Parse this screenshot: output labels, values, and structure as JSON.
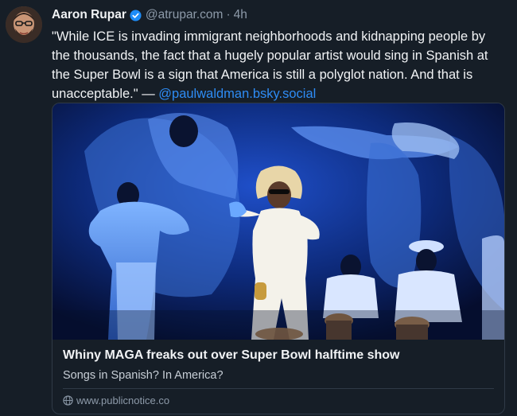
{
  "post": {
    "author": {
      "display_name": "Aaron Rupar",
      "handle": "@atrupar.com",
      "verified": true
    },
    "separator": "·",
    "time": "4h",
    "text_quote": "\"While ICE is invading immigrant neighborhoods and kidnapping people by the thousands, the fact that a hugely popular artist would sing in Spanish at the Super Bowl is a sign that America is still a polyglot nation. And that is unacceptable.\" — ",
    "text_mention": "@paulwaldman.bsky.social"
  },
  "link_card": {
    "title": "Whiny MAGA freaks out over Super Bowl halftime show",
    "description": "Songs in Spanish? In America?",
    "domain": "www.publicnotice.co",
    "domain_icon": "globe-icon"
  },
  "colors": {
    "background": "#161e27",
    "text": "#f1f3f5",
    "muted": "#8d9aa9",
    "link": "#2e8cf5",
    "verified": "#1d8cf8",
    "border": "#2f3a47"
  }
}
